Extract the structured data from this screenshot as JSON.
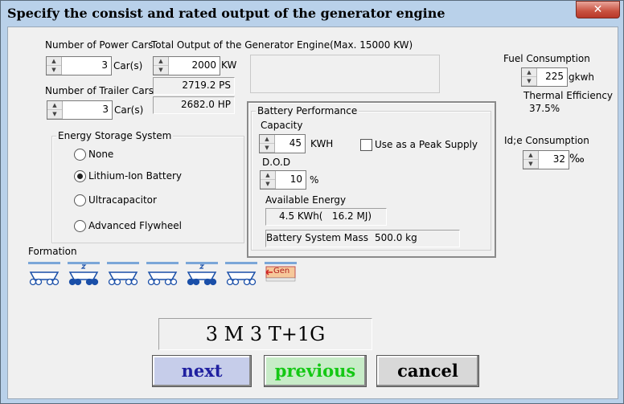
{
  "window": {
    "title": "Specify the consist and rated output of the generator engine",
    "close_glyph": "✕"
  },
  "power_cars": {
    "label": "Number of Power Cars",
    "value": "3",
    "unit": "Car(s)"
  },
  "trailer_cars": {
    "label": "Number of Trailer Cars",
    "value": "3",
    "unit": "Car(s)"
  },
  "output": {
    "label": "Total Output of the Generator Engine(Max. 15000 KW)",
    "kw_value": "2000",
    "kw_unit": "KW",
    "ps": "2719.2 PS",
    "hp": "2682.0 HP"
  },
  "fuel": {
    "label": "Fuel Consumption",
    "value": "225",
    "unit": "gkwh",
    "thermal_label": "Thermal Efficiency",
    "thermal_value": "37.5%"
  },
  "idle": {
    "label": "Id;e Consumption",
    "value": "32",
    "unit": "‰"
  },
  "energy_storage": {
    "label": "Energy Storage System",
    "options": [
      {
        "label": "None",
        "selected": false
      },
      {
        "label": "Lithium-Ion Battery",
        "selected": true
      },
      {
        "label": "Ultracapacitor",
        "selected": false
      },
      {
        "label": "Advanced Flywheel",
        "selected": false
      }
    ]
  },
  "battery": {
    "group_label": "Battery Performance",
    "capacity_label": "Capacity",
    "capacity_value": "45",
    "capacity_unit": "KWH",
    "peak_label": "Use as a Peak Supply",
    "peak_checked": false,
    "dod_label": "D.O.D",
    "dod_value": "10",
    "dod_unit": "%",
    "available_label": "Available Energy",
    "available_value": "4.5 KWh(   16.2 MJ)",
    "mass_label": "Battery System Mass",
    "mass_value": "500.0 kg"
  },
  "formation": {
    "label": "Formation",
    "cars": [
      "trailer-car",
      "power-car",
      "trailer-car",
      "trailer-car",
      "power-car",
      "trailer-car",
      "generator-car"
    ],
    "generator_label": "Gen",
    "code": "3 M 3 T+1G"
  },
  "buttons": {
    "next": "next",
    "previous": "previous",
    "cancel": "cancel"
  },
  "colors": {
    "next_bg": "#c6cdea",
    "next_fg": "#2020a0",
    "previous_bg": "#c8ecc8",
    "previous_fg": "#14c814",
    "cancel_bg": "#d8d8d8",
    "cancel_fg": "#000000",
    "car_blue": "#1a4fa8"
  }
}
